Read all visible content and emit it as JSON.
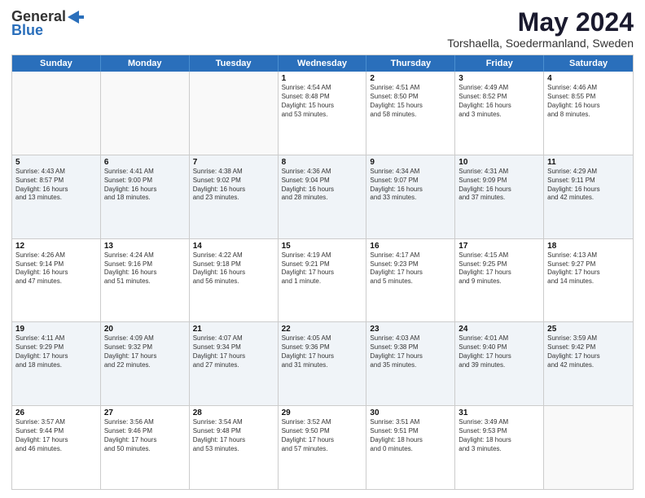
{
  "logo": {
    "general": "General",
    "blue": "Blue"
  },
  "title": {
    "month_year": "May 2024",
    "location": "Torshaella, Soedermanland, Sweden"
  },
  "header_days": [
    "Sunday",
    "Monday",
    "Tuesday",
    "Wednesday",
    "Thursday",
    "Friday",
    "Saturday"
  ],
  "rows": [
    [
      {
        "day": "",
        "info": ""
      },
      {
        "day": "",
        "info": ""
      },
      {
        "day": "",
        "info": ""
      },
      {
        "day": "1",
        "info": "Sunrise: 4:54 AM\nSunset: 8:48 PM\nDaylight: 15 hours\nand 53 minutes."
      },
      {
        "day": "2",
        "info": "Sunrise: 4:51 AM\nSunset: 8:50 PM\nDaylight: 15 hours\nand 58 minutes."
      },
      {
        "day": "3",
        "info": "Sunrise: 4:49 AM\nSunset: 8:52 PM\nDaylight: 16 hours\nand 3 minutes."
      },
      {
        "day": "4",
        "info": "Sunrise: 4:46 AM\nSunset: 8:55 PM\nDaylight: 16 hours\nand 8 minutes."
      }
    ],
    [
      {
        "day": "5",
        "info": "Sunrise: 4:43 AM\nSunset: 8:57 PM\nDaylight: 16 hours\nand 13 minutes."
      },
      {
        "day": "6",
        "info": "Sunrise: 4:41 AM\nSunset: 9:00 PM\nDaylight: 16 hours\nand 18 minutes."
      },
      {
        "day": "7",
        "info": "Sunrise: 4:38 AM\nSunset: 9:02 PM\nDaylight: 16 hours\nand 23 minutes."
      },
      {
        "day": "8",
        "info": "Sunrise: 4:36 AM\nSunset: 9:04 PM\nDaylight: 16 hours\nand 28 minutes."
      },
      {
        "day": "9",
        "info": "Sunrise: 4:34 AM\nSunset: 9:07 PM\nDaylight: 16 hours\nand 33 minutes."
      },
      {
        "day": "10",
        "info": "Sunrise: 4:31 AM\nSunset: 9:09 PM\nDaylight: 16 hours\nand 37 minutes."
      },
      {
        "day": "11",
        "info": "Sunrise: 4:29 AM\nSunset: 9:11 PM\nDaylight: 16 hours\nand 42 minutes."
      }
    ],
    [
      {
        "day": "12",
        "info": "Sunrise: 4:26 AM\nSunset: 9:14 PM\nDaylight: 16 hours\nand 47 minutes."
      },
      {
        "day": "13",
        "info": "Sunrise: 4:24 AM\nSunset: 9:16 PM\nDaylight: 16 hours\nand 51 minutes."
      },
      {
        "day": "14",
        "info": "Sunrise: 4:22 AM\nSunset: 9:18 PM\nDaylight: 16 hours\nand 56 minutes."
      },
      {
        "day": "15",
        "info": "Sunrise: 4:19 AM\nSunset: 9:21 PM\nDaylight: 17 hours\nand 1 minute."
      },
      {
        "day": "16",
        "info": "Sunrise: 4:17 AM\nSunset: 9:23 PM\nDaylight: 17 hours\nand 5 minutes."
      },
      {
        "day": "17",
        "info": "Sunrise: 4:15 AM\nSunset: 9:25 PM\nDaylight: 17 hours\nand 9 minutes."
      },
      {
        "day": "18",
        "info": "Sunrise: 4:13 AM\nSunset: 9:27 PM\nDaylight: 17 hours\nand 14 minutes."
      }
    ],
    [
      {
        "day": "19",
        "info": "Sunrise: 4:11 AM\nSunset: 9:29 PM\nDaylight: 17 hours\nand 18 minutes."
      },
      {
        "day": "20",
        "info": "Sunrise: 4:09 AM\nSunset: 9:32 PM\nDaylight: 17 hours\nand 22 minutes."
      },
      {
        "day": "21",
        "info": "Sunrise: 4:07 AM\nSunset: 9:34 PM\nDaylight: 17 hours\nand 27 minutes."
      },
      {
        "day": "22",
        "info": "Sunrise: 4:05 AM\nSunset: 9:36 PM\nDaylight: 17 hours\nand 31 minutes."
      },
      {
        "day": "23",
        "info": "Sunrise: 4:03 AM\nSunset: 9:38 PM\nDaylight: 17 hours\nand 35 minutes."
      },
      {
        "day": "24",
        "info": "Sunrise: 4:01 AM\nSunset: 9:40 PM\nDaylight: 17 hours\nand 39 minutes."
      },
      {
        "day": "25",
        "info": "Sunrise: 3:59 AM\nSunset: 9:42 PM\nDaylight: 17 hours\nand 42 minutes."
      }
    ],
    [
      {
        "day": "26",
        "info": "Sunrise: 3:57 AM\nSunset: 9:44 PM\nDaylight: 17 hours\nand 46 minutes."
      },
      {
        "day": "27",
        "info": "Sunrise: 3:56 AM\nSunset: 9:46 PM\nDaylight: 17 hours\nand 50 minutes."
      },
      {
        "day": "28",
        "info": "Sunrise: 3:54 AM\nSunset: 9:48 PM\nDaylight: 17 hours\nand 53 minutes."
      },
      {
        "day": "29",
        "info": "Sunrise: 3:52 AM\nSunset: 9:50 PM\nDaylight: 17 hours\nand 57 minutes."
      },
      {
        "day": "30",
        "info": "Sunrise: 3:51 AM\nSunset: 9:51 PM\nDaylight: 18 hours\nand 0 minutes."
      },
      {
        "day": "31",
        "info": "Sunrise: 3:49 AM\nSunset: 9:53 PM\nDaylight: 18 hours\nand 3 minutes."
      },
      {
        "day": "",
        "info": ""
      }
    ]
  ]
}
